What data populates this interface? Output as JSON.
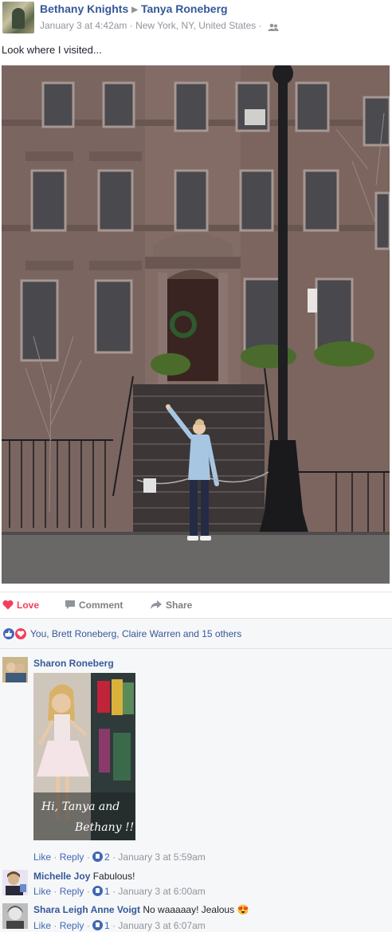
{
  "post": {
    "author": "Bethany Knights",
    "target": "Tanya Roneberg",
    "arrow": "▶",
    "timestamp": "January 3 at 4:42am",
    "location": "New York, NY, United States",
    "separator": "·",
    "caption": "Look where I visited...",
    "privacy_icon": "friends-icon"
  },
  "actions": {
    "love": "Love",
    "comment": "Comment",
    "share": "Share"
  },
  "reactions": {
    "text": "You, Brett Roneberg, Claire Warren and 15 others",
    "icons": [
      "like-icon",
      "love-icon"
    ]
  },
  "comments": [
    {
      "name": "Sharon Roneberg",
      "text": "",
      "image_caption": "Hi, Tanya and Bethany !!",
      "like": "Like",
      "reply": "Reply",
      "likes": "2",
      "timestamp": "January 3 at 5:59am"
    },
    {
      "name": "Michelle Joy",
      "text": "Fabulous!",
      "like": "Like",
      "reply": "Reply",
      "likes": "1",
      "timestamp": "January 3 at 6:00am"
    },
    {
      "name": "Shara Leigh Anne Voigt",
      "text": "No waaaaay! Jealous",
      "emoji": "😍",
      "like": "Like",
      "reply": "Reply",
      "likes": "1",
      "timestamp": "January 3 at 6:07am"
    }
  ],
  "colors": {
    "link": "#365899",
    "love": "#f33e58",
    "like": "#4267b2",
    "muted": "#90949c"
  }
}
